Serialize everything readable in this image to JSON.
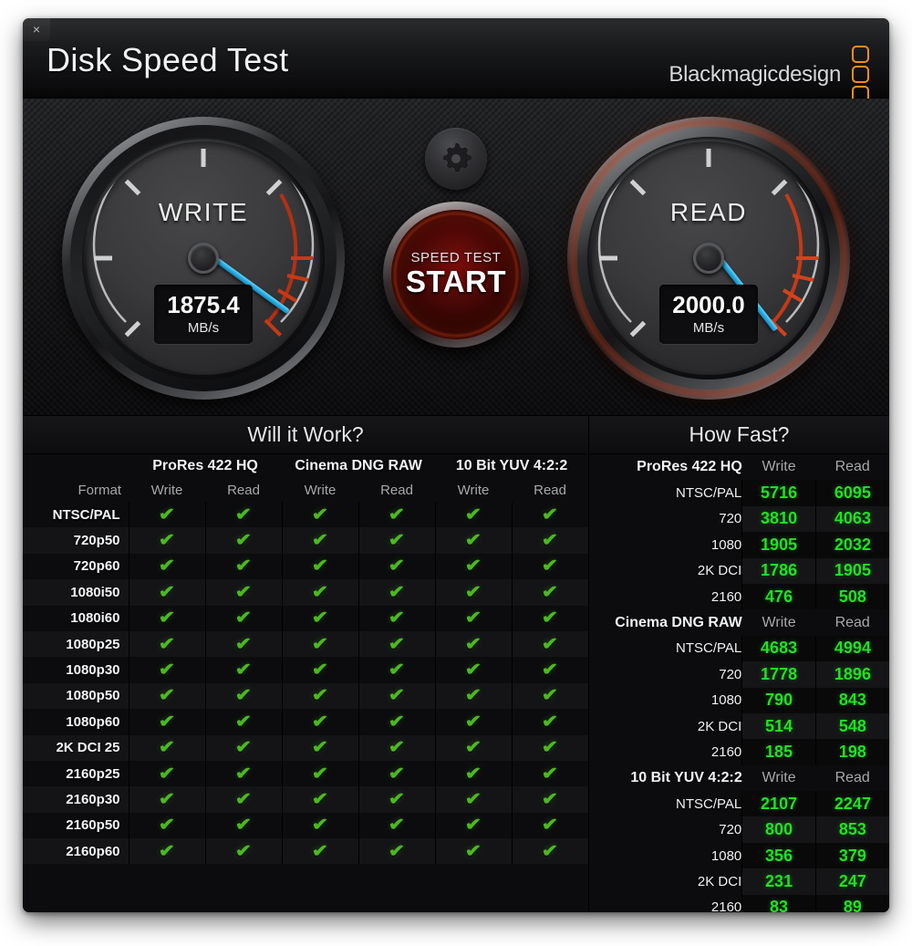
{
  "window": {
    "title": "Disk Speed Test",
    "close_label": "×",
    "brand": "Blackmagicdesign"
  },
  "gauges": {
    "write": {
      "label": "WRITE",
      "value": "1875.4",
      "unit": "MB/s",
      "needle_angle": 36,
      "active": false
    },
    "read": {
      "label": "READ",
      "value": "2000.0",
      "unit": "MB/s",
      "needle_angle": 52,
      "active": true
    },
    "settings_icon": "gear-icon",
    "start_button": {
      "sub_label": "SPEED TEST",
      "main_label": "START"
    }
  },
  "colors": {
    "needle": "#23a8e2",
    "check": "#4cb820",
    "value_green": "#22e024",
    "brand_orange": "#f0901e",
    "gauge_red": "#cf2a15"
  },
  "will_it_work": {
    "title": "Will it Work?",
    "format_header": "Format",
    "groups": [
      {
        "name": "ProRes 422 HQ",
        "columns": [
          "Write",
          "Read"
        ]
      },
      {
        "name": "Cinema DNG RAW",
        "columns": [
          "Write",
          "Read"
        ]
      },
      {
        "name": "10 Bit YUV 4:2:2",
        "columns": [
          "Write",
          "Read"
        ]
      }
    ],
    "check_glyph": "✔",
    "rows": [
      {
        "format": "NTSC/PAL",
        "cells": [
          true,
          true,
          true,
          true,
          true,
          true
        ]
      },
      {
        "format": "720p50",
        "cells": [
          true,
          true,
          true,
          true,
          true,
          true
        ]
      },
      {
        "format": "720p60",
        "cells": [
          true,
          true,
          true,
          true,
          true,
          true
        ]
      },
      {
        "format": "1080i50",
        "cells": [
          true,
          true,
          true,
          true,
          true,
          true
        ]
      },
      {
        "format": "1080i60",
        "cells": [
          true,
          true,
          true,
          true,
          true,
          true
        ]
      },
      {
        "format": "1080p25",
        "cells": [
          true,
          true,
          true,
          true,
          true,
          true
        ]
      },
      {
        "format": "1080p30",
        "cells": [
          true,
          true,
          true,
          true,
          true,
          true
        ]
      },
      {
        "format": "1080p50",
        "cells": [
          true,
          true,
          true,
          true,
          true,
          true
        ]
      },
      {
        "format": "1080p60",
        "cells": [
          true,
          true,
          true,
          true,
          true,
          true
        ]
      },
      {
        "format": "2K DCI 25",
        "cells": [
          true,
          true,
          true,
          true,
          true,
          true
        ]
      },
      {
        "format": "2160p25",
        "cells": [
          true,
          true,
          true,
          true,
          true,
          true
        ]
      },
      {
        "format": "2160p30",
        "cells": [
          true,
          true,
          true,
          true,
          true,
          true
        ]
      },
      {
        "format": "2160p50",
        "cells": [
          true,
          true,
          true,
          true,
          true,
          true
        ]
      },
      {
        "format": "2160p60",
        "cells": [
          true,
          true,
          true,
          true,
          true,
          true
        ]
      }
    ]
  },
  "how_fast": {
    "title": "How Fast?",
    "column_headers": [
      "Write",
      "Read"
    ],
    "groups": [
      {
        "name": "ProRes 422 HQ",
        "rows": [
          {
            "label": "NTSC/PAL",
            "write": "5716",
            "read": "6095"
          },
          {
            "label": "720",
            "write": "3810",
            "read": "4063"
          },
          {
            "label": "1080",
            "write": "1905",
            "read": "2032"
          },
          {
            "label": "2K DCI",
            "write": "1786",
            "read": "1905"
          },
          {
            "label": "2160",
            "write": "476",
            "read": "508"
          }
        ]
      },
      {
        "name": "Cinema DNG RAW",
        "rows": [
          {
            "label": "NTSC/PAL",
            "write": "4683",
            "read": "4994"
          },
          {
            "label": "720",
            "write": "1778",
            "read": "1896"
          },
          {
            "label": "1080",
            "write": "790",
            "read": "843"
          },
          {
            "label": "2K DCI",
            "write": "514",
            "read": "548"
          },
          {
            "label": "2160",
            "write": "185",
            "read": "198"
          }
        ]
      },
      {
        "name": "10 Bit YUV 4:2:2",
        "rows": [
          {
            "label": "NTSC/PAL",
            "write": "2107",
            "read": "2247"
          },
          {
            "label": "720",
            "write": "800",
            "read": "853"
          },
          {
            "label": "1080",
            "write": "356",
            "read": "379"
          },
          {
            "label": "2K DCI",
            "write": "231",
            "read": "247"
          },
          {
            "label": "2160",
            "write": "83",
            "read": "89"
          }
        ]
      }
    ]
  }
}
